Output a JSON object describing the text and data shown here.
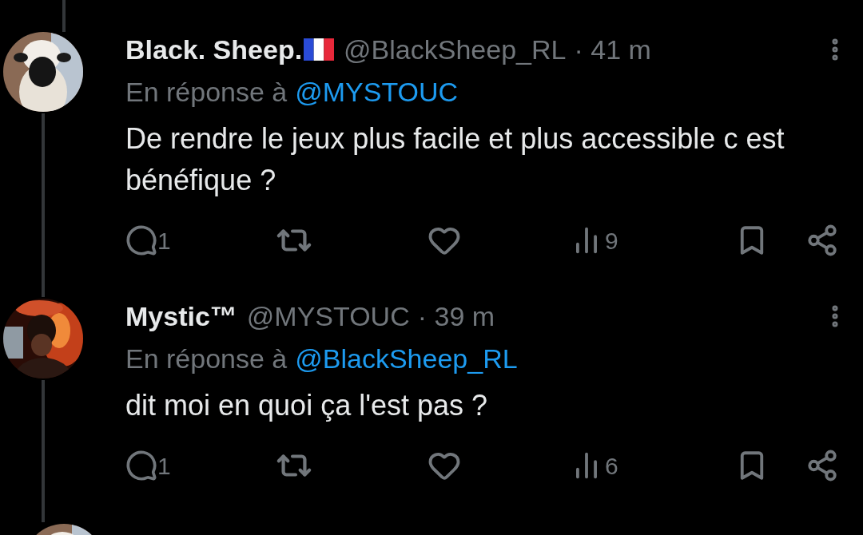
{
  "tweets": [
    {
      "name": "Black. Sheep.",
      "flag": true,
      "handle": "@BlackSheep_RL",
      "time": "· 41 m",
      "reply_prefix": "En réponse à",
      "reply_to": "@MYSTOUC",
      "text": "De rendre le jeux plus facile et plus accessible c est bénéfique ?",
      "replies": "1",
      "views": "9"
    },
    {
      "name": "Mystic™",
      "flag": false,
      "handle": "@MYSTOUC",
      "time": "· 39 m",
      "reply_prefix": "En réponse à",
      "reply_to": "@BlackSheep_RL",
      "text": "dit moi en quoi ça l'est pas ?",
      "replies": "1",
      "views": "6"
    }
  ]
}
